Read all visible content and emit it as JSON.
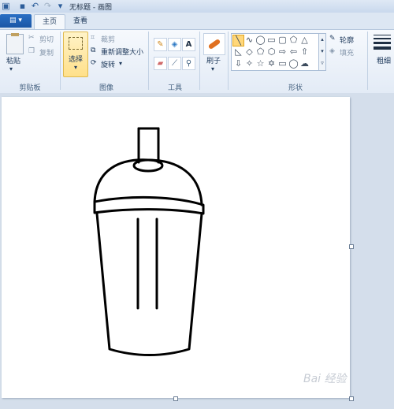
{
  "titlebar": {
    "title": "无标题 - 画图"
  },
  "tabs": {
    "file_label": "▤ ▾",
    "home": "主页",
    "view": "查看"
  },
  "clipboard": {
    "paste": "粘贴",
    "cut": "剪切",
    "copy": "复制",
    "group": "剪贴板"
  },
  "image": {
    "select": "选择",
    "crop": "裁剪",
    "resize": "重新调整大小",
    "rotate": "旋转",
    "group": "图像"
  },
  "tools": {
    "group": "工具",
    "text_tool": "A"
  },
  "brushes": {
    "label": "刷子"
  },
  "shapes": {
    "group": "形状",
    "outline": "轮廓",
    "fill": "填充"
  },
  "size": {
    "label": "粗细"
  },
  "watermark": {
    "text": "Bai 经验"
  },
  "colors": {
    "accent": "#2a6fc4",
    "select_highlight": "#ffe08a"
  }
}
